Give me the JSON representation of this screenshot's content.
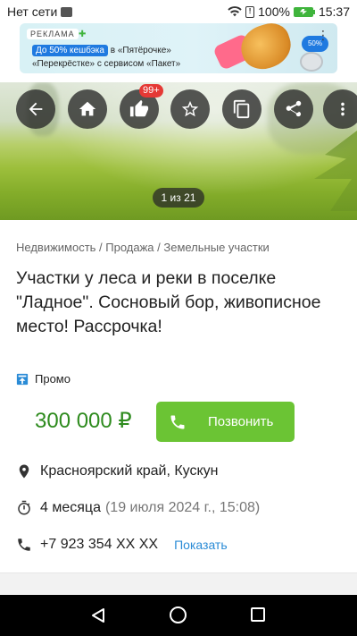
{
  "status_bar": {
    "carrier": "Нет сети",
    "battery": "100%",
    "time": "15:37"
  },
  "ad": {
    "label": "РЕКЛАМА",
    "highlight": "До 50% кешбэка",
    "line1_rest": " в «Пятёрочке»",
    "line2": "«Перекрёстке» с сервисом «Пакет»",
    "badge": "50%"
  },
  "photo": {
    "notifications": "99+",
    "counter": "1 из 21"
  },
  "listing": {
    "breadcrumb": "Недвижимость / Продажа / Земельные участки",
    "title": "Участки у леса и реки в поселке \"Ладное\". Сосновый бор, живописное место! Рассрочка!",
    "promo": "Промо",
    "price": "300 000 ₽",
    "call_label": "Позвонить",
    "location": "Красноярский край, Кускун",
    "age": "4 месяца",
    "date": "(19 июля 2024 г., 15:08)",
    "phone": "+7 923 354 XX XX",
    "show_phone": "Показать"
  },
  "colors": {
    "price": "#2e8b1e",
    "call_button": "#6bc434",
    "link": "#2a8bd6",
    "notification": "#e53935"
  }
}
